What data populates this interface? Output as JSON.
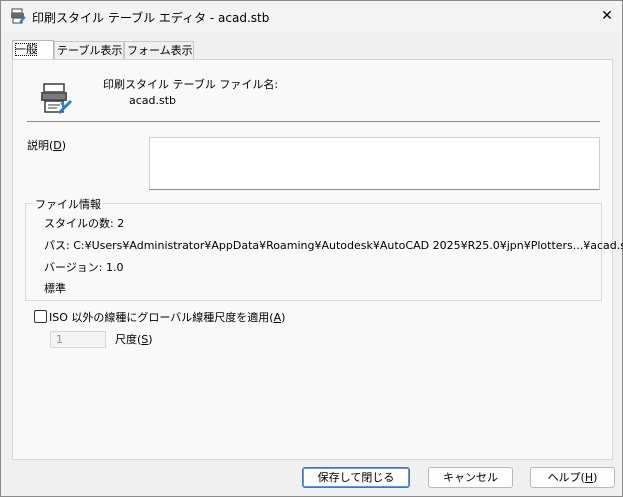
{
  "window": {
    "title": "印刷スタイル テーブル エディタ - acad.stb",
    "close_glyph": "✕"
  },
  "tabs": [
    {
      "label": "一般",
      "active": true
    },
    {
      "label": "テーブル表示",
      "active": false
    },
    {
      "label": "フォーム表示",
      "active": false
    }
  ],
  "general": {
    "file_label": "印刷スタイル テーブル ファイル名:",
    "file_name": "acad.stb",
    "description_label": "説明(",
    "description_mnemonic": "D",
    "description_label_end": ")",
    "description_value": "",
    "file_info": {
      "title": "ファイル情報",
      "style_count": "スタイルの数: 2",
      "path": "パス: C:¥Users¥Administrator¥AppData¥Roaming¥Autodesk¥AutoCAD 2025¥R25.0¥jpn¥Plotters...¥acad.stb",
      "version": "バージョン: 1.0",
      "standard": "標準"
    },
    "apply_scale": {
      "checked": false,
      "label": "ISO 以外の線種にグローバル線種尺度を適用(",
      "mnemonic": "A",
      "label_end": ")"
    },
    "scale": {
      "value": "1",
      "label": "尺度(",
      "mnemonic": "S",
      "label_end": ")"
    }
  },
  "buttons": {
    "save_close": "保存して閉じる",
    "cancel": "キャンセル",
    "help": "ヘルプ(",
    "help_mnemonic": "H",
    "help_end": ")"
  },
  "colors": {
    "accent": "#4a74b8",
    "icon_blue": "#2a7fd4"
  },
  "icons": {
    "title": "plotter-style-icon",
    "file": "plotter-style-table-icon"
  }
}
